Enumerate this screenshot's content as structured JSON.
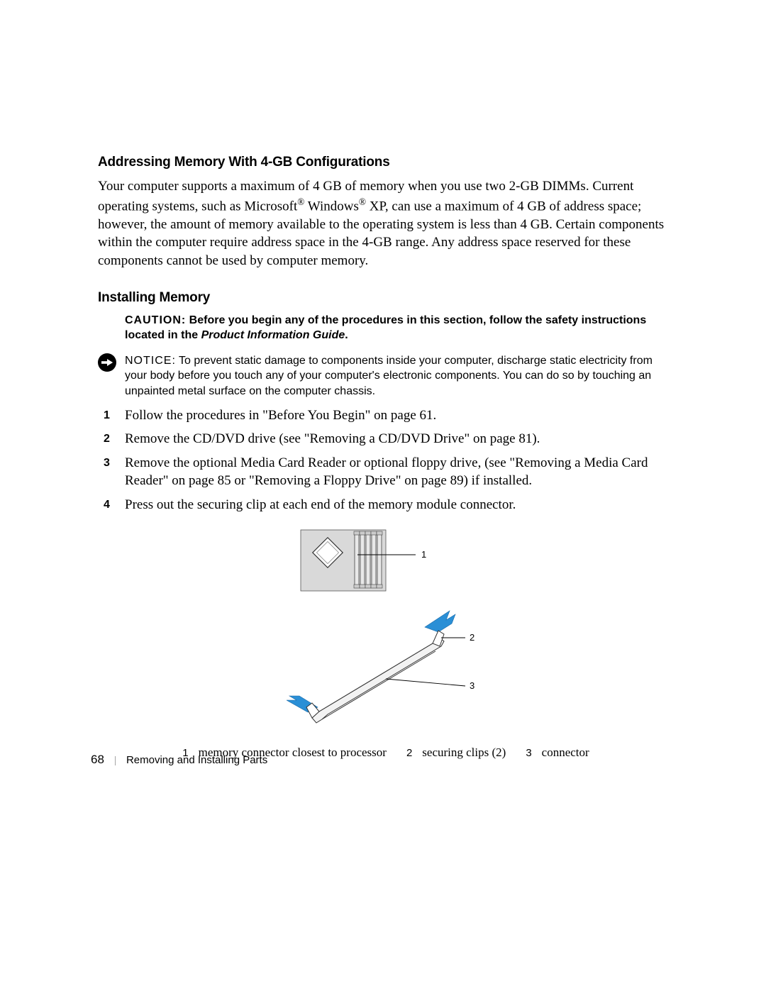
{
  "section1": {
    "heading": "Addressing Memory With 4-GB Configurations",
    "text": "Your computer supports a maximum of 4 GB of memory when you use two 2-GB DIMMs. Current operating systems, such as Microsoft® Windows® XP, can use a maximum of 4 GB of address space; however, the amount of memory available to the operating system is less than 4 GB. Certain components within the computer require address space in the 4-GB range. Any address space reserved for these components cannot be used by computer memory."
  },
  "section2": {
    "heading": "Installing Memory",
    "caution": {
      "label": "CAUTION:",
      "text": "Before you begin any of the procedures in this section, follow the safety instructions located in the ",
      "ref": "Product Information Guide",
      "suffix": "."
    },
    "notice": {
      "label": "NOTICE:",
      "text": "To prevent static damage to components inside your computer, discharge static electricity from your body before you touch any of your computer's electronic components. You can do so by touching an unpainted metal surface on the computer chassis."
    },
    "steps": [
      "Follow the procedures in \"Before You Begin\" on page 61.",
      "Remove the CD/DVD drive (see \"Removing a CD/DVD Drive\" on page 81).",
      "Remove the optional Media Card Reader or optional floppy drive, (see \"Removing a Media Card Reader\" on page 85 or \"Removing a Floppy Drive\" on page 89) if installed.",
      "Press out the securing clip at each end of the memory module connector."
    ]
  },
  "callouts": [
    {
      "n": "1",
      "label": "memory connector closest to processor"
    },
    {
      "n": "2",
      "label": "securing clips (2)"
    },
    {
      "n": "3",
      "label": "connector"
    }
  ],
  "diagram_labels": {
    "a": "1",
    "b": "2",
    "c": "3"
  },
  "footer": {
    "page_number": "68",
    "separator": "|",
    "section_name": "Removing and Installing Parts"
  }
}
